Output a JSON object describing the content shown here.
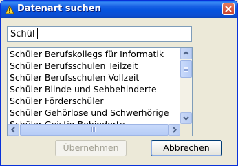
{
  "window": {
    "title": "Datenart suchen",
    "icon": "warning-icon"
  },
  "search": {
    "value": "Schül"
  },
  "list": {
    "items": [
      "Schüler Berufskollegs für Informatik",
      "Schüler Berufsschulen Teilzeit",
      "Schüler Berufsschulen Vollzeit",
      "Schüler Blinde und Sehbehinderte",
      "Schüler Förderschüler",
      "Schüler Gehörlose und Schwerhörige",
      "Schüler Geistig Behinderte"
    ]
  },
  "buttons": {
    "ok_label": "Übernehmen",
    "cancel_label": "Abbrechen"
  },
  "colors": {
    "titlebar": "#0553DE",
    "window_bg": "#ECE9D8",
    "close_button": "#C7412D"
  }
}
